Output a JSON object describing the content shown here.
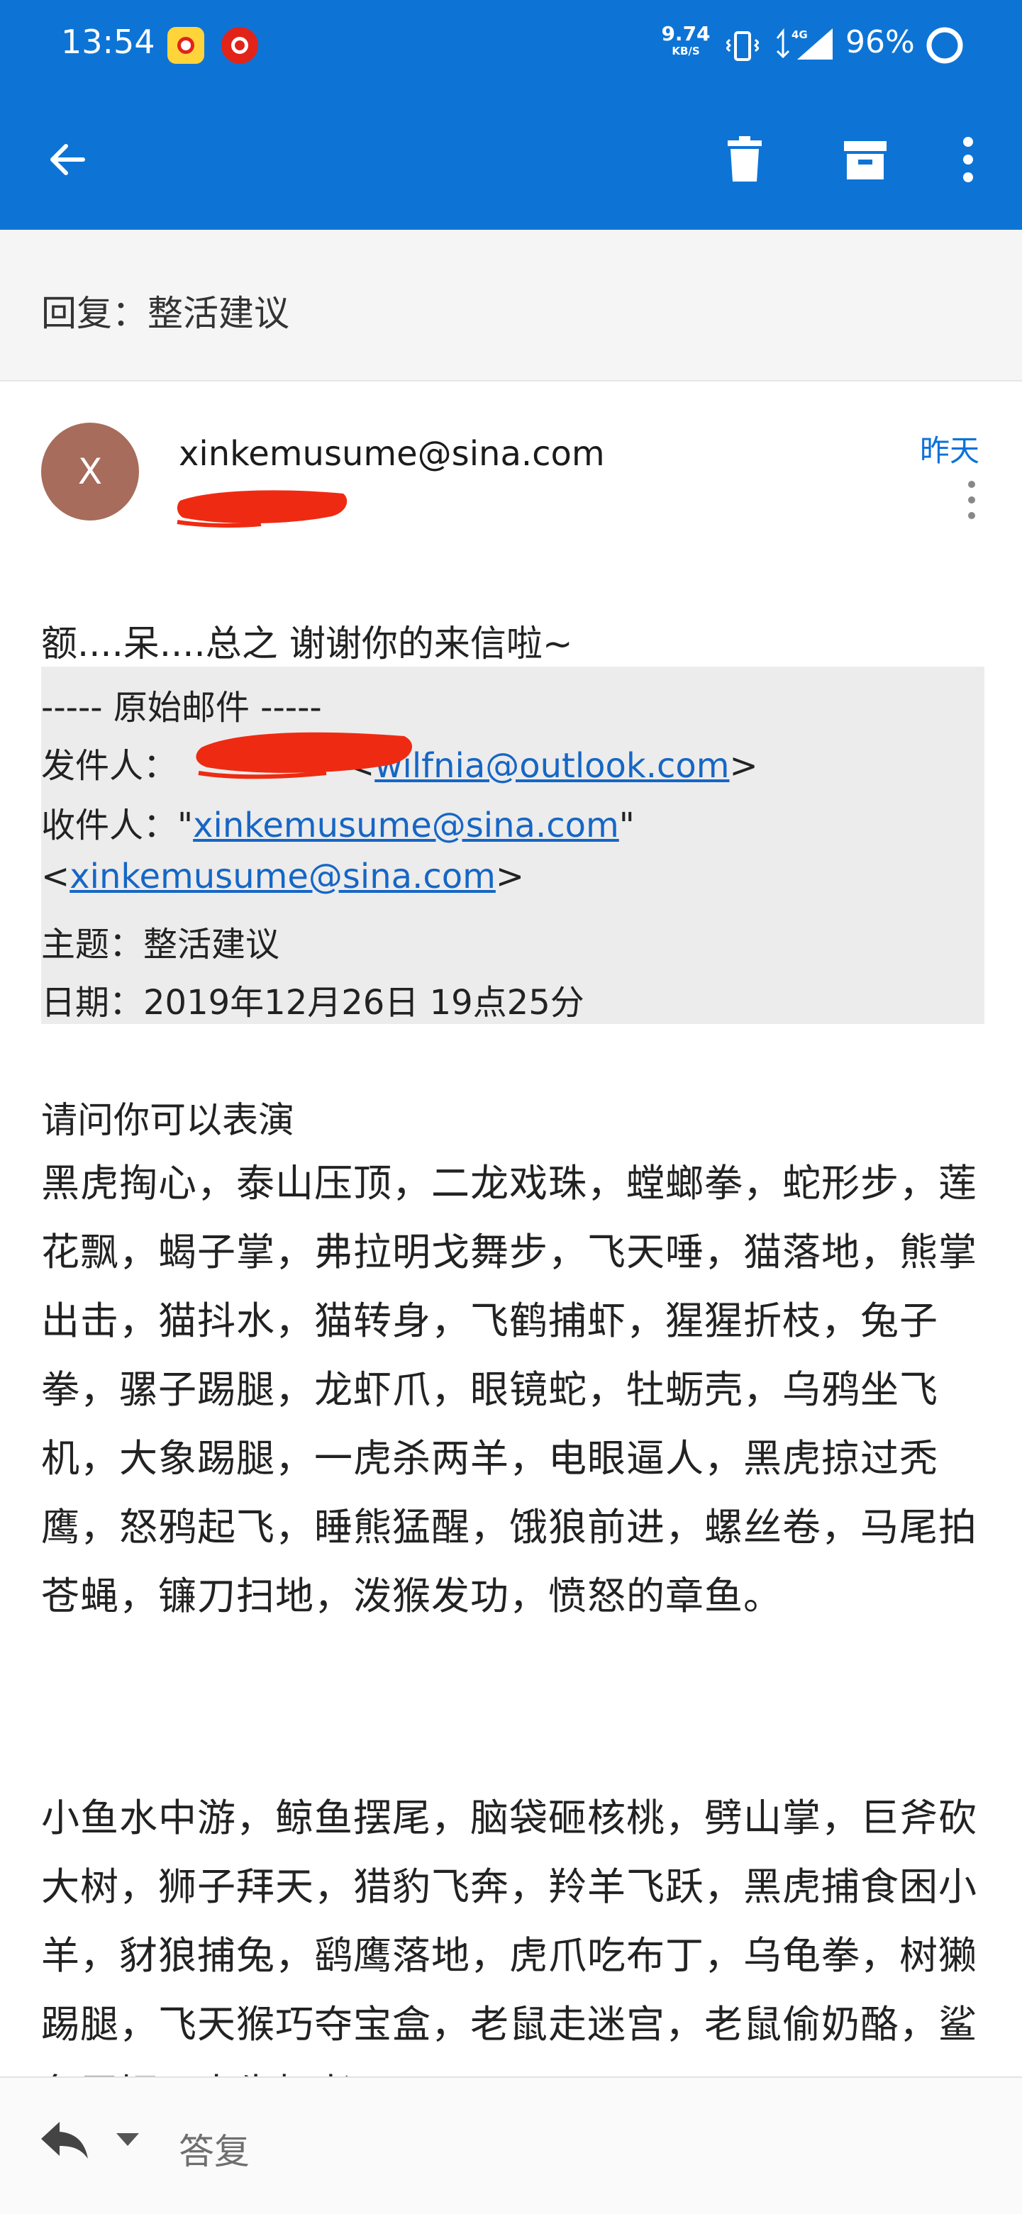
{
  "status_bar": {
    "time": "13:54",
    "net_speed_value": "9.74",
    "net_speed_unit": "KB/S",
    "network_type": "4G",
    "battery": "96%",
    "icons": [
      "weibo-app-icon",
      "netease-music-app-icon",
      "vibrate-icon",
      "signal-icon",
      "battery-icon"
    ]
  },
  "toolbar": {
    "icons": [
      "back-arrow-icon",
      "trash-icon",
      "archive-icon",
      "more-vertical-icon"
    ]
  },
  "subject": "回复：整活建议",
  "message": {
    "avatar_letter": "X",
    "sender": "xinkemusume@sina.com",
    "date": "昨天",
    "intro": "额....呆....总之 谢谢你的来信啦~"
  },
  "quote": {
    "header": "----- 原始邮件 -----",
    "from_label": "发件人：",
    "from_email": "wilfnia@outlook.com",
    "to_label": "收件人：",
    "to_email": "xinkemusume@sina.com",
    "subject_line": "主题：整活建议",
    "date_line": "日期：2019年12月26日 19点25分"
  },
  "body": {
    "lead": "请问你可以表演",
    "paragraph1": "黑虎掏心，泰山压顶，二龙戏珠，螳螂拳，蛇形步，莲花飘，蝎子掌，弗拉明戈舞步，飞天唾，猫落地，熊掌出击，猫抖水，猫转身，飞鹤捕虾，猩猩折枝，兔子拳，骡子踢腿，龙虾爪，眼镜蛇，牡蛎壳，乌鸦坐飞机，大象踢腿，一虎杀两羊，电眼逼人，黑虎掠过秃鹰，怒鸦起飞，睡熊猛醒，饿狼前进，螺丝卷，马尾拍苍蝇，镰刀扫地，泼猴发功，愤怒的章鱼。",
    "paragraph2": "小鱼水中游，鲸鱼摆尾，脑袋砸核桃，劈山掌，巨斧砍大树，狮子拜天，猎豹飞奔，羚羊飞跃，黑虎捕食困小羊，豺狼捕兔，鹞鹰落地，虎爪吃布丁，乌龟拳，树獭踢腿，飞天猴巧夺宝盒，老鼠走迷宫，老鼠偷奶酪，鲨鱼吞饵，水牛打老"
  },
  "reply_bar": {
    "label": "答复"
  },
  "colors": {
    "primary": "#0d74d6",
    "link": "#1666c5",
    "avatar": "#a76c5b",
    "redaction": "#ee2b12"
  }
}
